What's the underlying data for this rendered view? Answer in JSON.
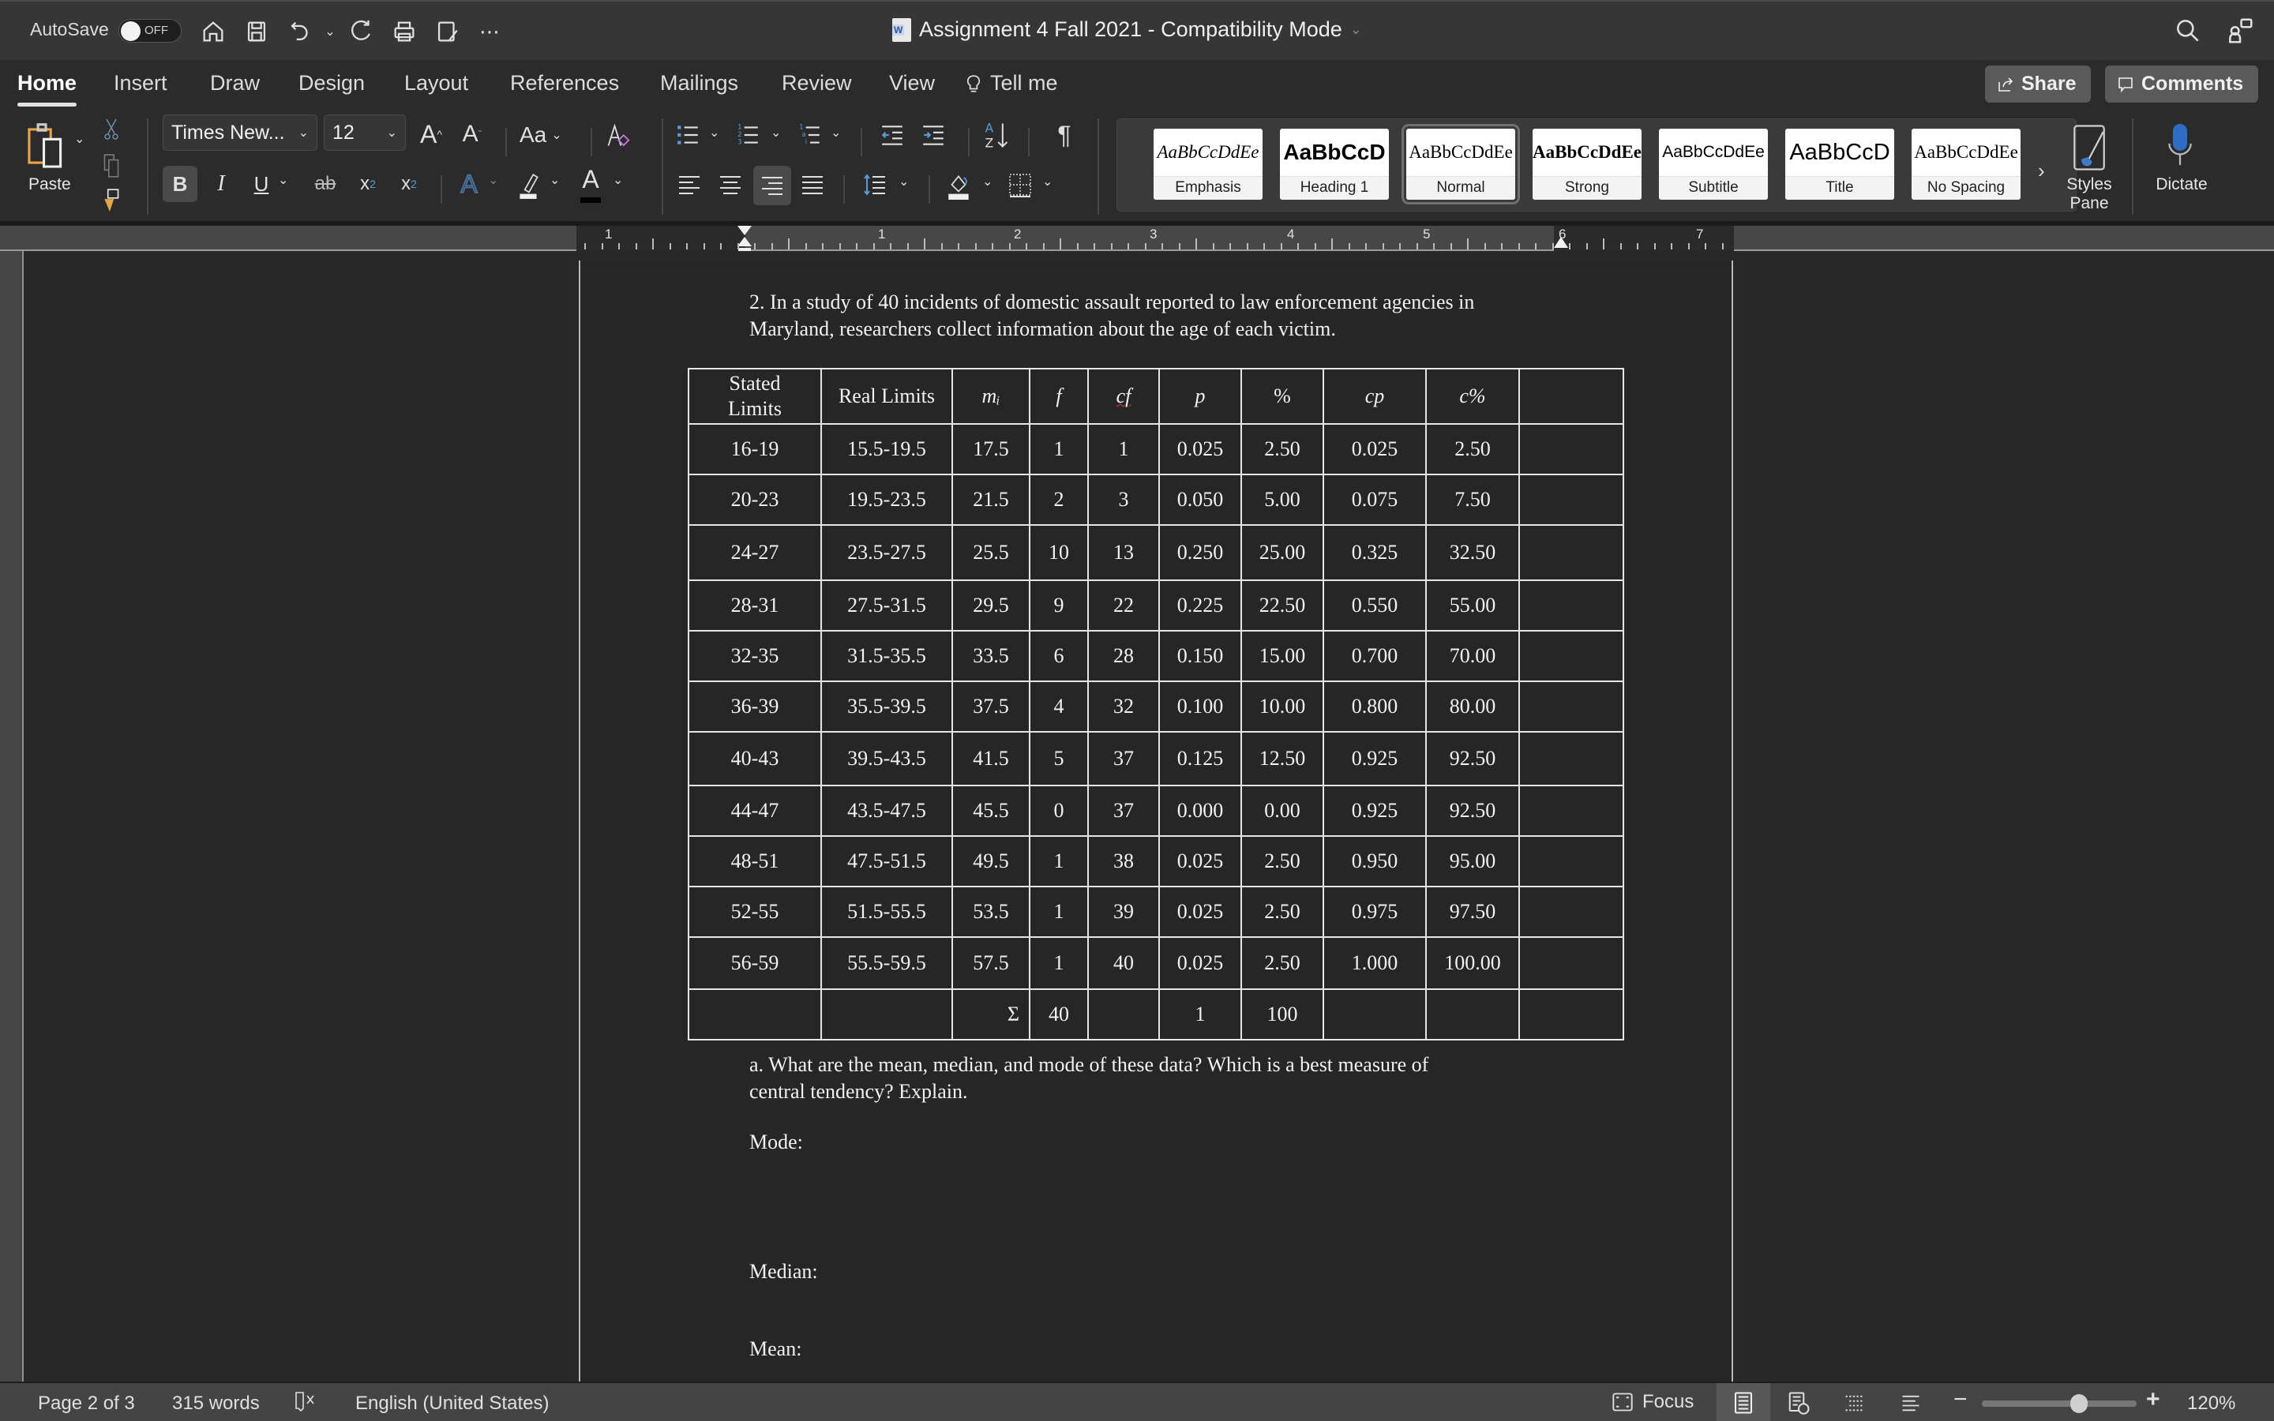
{
  "titlebar": {
    "autosave_label": "AutoSave",
    "autosave_state": "OFF",
    "document_title": "Assignment 4 Fall 2021  -  Compatibility Mode",
    "quick_access_icons": [
      "home-icon",
      "save-icon",
      "undo-icon",
      "redo-icon",
      "print-icon",
      "edit-save-icon",
      "more-icon"
    ],
    "right_icons": [
      "search-icon",
      "share-people-icon"
    ]
  },
  "tabs": [
    {
      "label": "Home",
      "active": true
    },
    {
      "label": "Insert"
    },
    {
      "label": "Draw"
    },
    {
      "label": "Design"
    },
    {
      "label": "Layout"
    },
    {
      "label": "References"
    },
    {
      "label": "Mailings"
    },
    {
      "label": "Review"
    },
    {
      "label": "View"
    },
    {
      "label": "Tell me"
    }
  ],
  "header_buttons": {
    "share": "Share",
    "comments": "Comments"
  },
  "ribbon": {
    "paste_label": "Paste",
    "font_name": "Times New...",
    "font_size": "12",
    "change_case_label": "Aa",
    "bold": "B",
    "italic": "I",
    "underline": "U",
    "strikethrough": "ab",
    "subscript": "x",
    "subscript_mark": "2",
    "superscript": "x",
    "superscript_mark": "2",
    "font_color_letter": "A",
    "active_alignment": "right",
    "pilcrow": "¶",
    "styles": [
      {
        "sample": "AaBbCcDdEe",
        "name": "Emphasis"
      },
      {
        "sample": "AaBbCcD",
        "name": "Heading 1"
      },
      {
        "sample": "AaBbCcDdEe",
        "name": "Normal",
        "selected": true
      },
      {
        "sample": "AaBbCcDdEe",
        "name": "Strong"
      },
      {
        "sample": "AaBbCcDdEe",
        "name": "Subtitle"
      },
      {
        "sample": "AaBbCcD",
        "name": "Title"
      },
      {
        "sample": "AaBbCcDdEe",
        "name": "No Spacing"
      }
    ],
    "styles_pane_label": "Styles Pane",
    "dictate_label": "Dictate"
  },
  "ruler": {
    "numbers": [
      "1",
      "1",
      "2",
      "3",
      "4",
      "5",
      "6",
      "7"
    ]
  },
  "document": {
    "question_text_line1": "2. In a study of 40 incidents of domestic assault reported to law enforcement agencies in",
    "question_text_line2": "Maryland, researchers collect information about the age of each victim.",
    "table": {
      "headers": [
        "Stated Limits",
        "Real Limits",
        "mᵢ",
        "f",
        "cf",
        "p",
        "%",
        "cp",
        "c%",
        ""
      ],
      "rows": [
        [
          "16-19",
          "15.5-19.5",
          "17.5",
          "1",
          "1",
          "0.025",
          "2.50",
          "0.025",
          "2.50",
          ""
        ],
        [
          "20-23",
          "19.5-23.5",
          "21.5",
          "2",
          "3",
          "0.050",
          "5.00",
          "0.075",
          "7.50",
          ""
        ],
        [
          "24-27",
          "23.5-27.5",
          "25.5",
          "10",
          "13",
          "0.250",
          "25.00",
          "0.325",
          "32.50",
          ""
        ],
        [
          "28-31",
          "27.5-31.5",
          "29.5",
          "9",
          "22",
          "0.225",
          "22.50",
          "0.550",
          "55.00",
          ""
        ],
        [
          "32-35",
          "31.5-35.5",
          "33.5",
          "6",
          "28",
          "0.150",
          "15.00",
          "0.700",
          "70.00",
          ""
        ],
        [
          "36-39",
          "35.5-39.5",
          "37.5",
          "4",
          "32",
          "0.100",
          "10.00",
          "0.800",
          "80.00",
          ""
        ],
        [
          "40-43",
          "39.5-43.5",
          "41.5",
          "5",
          "37",
          "0.125",
          "12.50",
          "0.925",
          "92.50",
          ""
        ],
        [
          "44-47",
          "43.5-47.5",
          "45.5",
          "0",
          "37",
          "0.000",
          "0.00",
          "0.925",
          "92.50",
          ""
        ],
        [
          "48-51",
          "47.5-51.5",
          "49.5",
          "1",
          "38",
          "0.025",
          "2.50",
          "0.950",
          "95.00",
          ""
        ],
        [
          "52-55",
          "51.5-55.5",
          "53.5",
          "1",
          "39",
          "0.025",
          "2.50",
          "0.975",
          "97.50",
          ""
        ],
        [
          "56-59",
          "55.5-59.5",
          "57.5",
          "1",
          "40",
          "0.025",
          "2.50",
          "1.000",
          "100.00",
          ""
        ]
      ],
      "totals": [
        "",
        "",
        "Σ",
        "40",
        "",
        "1",
        "100",
        "",
        "",
        ""
      ]
    },
    "subquestion_line1": "a. What are the mean, median, and mode of these data?  Which is a best measure of",
    "subquestion_line2": "central tendency? Explain.",
    "mode_label": "Mode:",
    "median_label": "Median:",
    "mean_label": "Mean:"
  },
  "statusbar": {
    "page": "Page 2 of 3",
    "words": "315 words",
    "language": "English (United States)",
    "focus_label": "Focus",
    "zoom_level": "120%",
    "zoom_slider_fraction": 0.5
  }
}
